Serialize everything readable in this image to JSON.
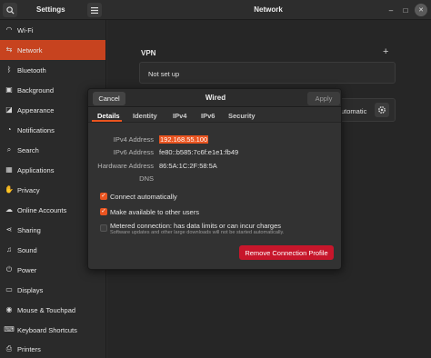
{
  "window": {
    "app_title": "Settings",
    "panel_title": "Network",
    "controls": {
      "minimize": "–",
      "maximize": "□",
      "close": "✕"
    }
  },
  "sidebar": {
    "items": [
      {
        "label": "Wi-Fi",
        "icon": "wifi-icon",
        "glyph": "◠",
        "active": false
      },
      {
        "label": "Network",
        "icon": "network-icon",
        "glyph": "⇆",
        "active": true
      },
      {
        "label": "Bluetooth",
        "icon": "bluetooth-icon",
        "glyph": "ᛒ",
        "active": false
      },
      {
        "label": "Background",
        "icon": "background-icon",
        "glyph": "▣",
        "active": false
      },
      {
        "label": "Appearance",
        "icon": "appearance-icon",
        "glyph": "◪",
        "active": false
      },
      {
        "label": "Notifications",
        "icon": "notifications-icon",
        "glyph": "◔",
        "active": false
      },
      {
        "label": "Search",
        "icon": "search-icon",
        "glyph": "⌕",
        "active": false
      },
      {
        "label": "Applications",
        "icon": "applications-icon",
        "glyph": "▦",
        "active": false
      },
      {
        "label": "Privacy",
        "icon": "privacy-icon",
        "glyph": "✋",
        "active": false
      },
      {
        "label": "Online Accounts",
        "icon": "online-accounts-icon",
        "glyph": "☁",
        "active": false
      },
      {
        "label": "Sharing",
        "icon": "sharing-icon",
        "glyph": "⋖",
        "active": false
      },
      {
        "label": "Sound",
        "icon": "sound-icon",
        "glyph": "♫",
        "active": false
      },
      {
        "label": "Power",
        "icon": "power-icon",
        "glyph": "⏻",
        "active": false
      },
      {
        "label": "Displays",
        "icon": "displays-icon",
        "glyph": "▭",
        "active": false
      },
      {
        "label": "Mouse & Touchpad",
        "icon": "mouse-icon",
        "glyph": "◉",
        "active": false
      },
      {
        "label": "Keyboard Shortcuts",
        "icon": "keyboard-icon",
        "glyph": "⌨",
        "active": false
      },
      {
        "label": "Printers",
        "icon": "printer-icon",
        "glyph": "⎙",
        "active": false
      }
    ]
  },
  "main": {
    "vpn": {
      "title": "VPN",
      "add": "+",
      "status": "Not set up"
    },
    "proxy": {
      "status": "Automatic"
    }
  },
  "dialog": {
    "title": "Wired",
    "cancel_label": "Cancel",
    "apply_label": "Apply",
    "tabs": [
      "Details",
      "Identity",
      "IPv4",
      "IPv6",
      "Security"
    ],
    "active_tab": "Details",
    "details": [
      {
        "label": "IPv4 Address",
        "value": "192.168.55.100"
      },
      {
        "label": "IPv6 Address",
        "value": "fe80::b585:7c6f:e1e1:fb49"
      },
      {
        "label": "Hardware Address",
        "value": "86:5A:1C:2F:58:5A"
      },
      {
        "label": "DNS",
        "value": ""
      }
    ],
    "options": [
      {
        "label": "Connect automatically",
        "checked": true
      },
      {
        "label": "Make available to other users",
        "checked": true
      },
      {
        "label": "Metered connection: has data limits or can incur charges",
        "checked": false,
        "sub": "Software updates and other large downloads will not be started automatically."
      }
    ],
    "remove_label": "Remove Connection Profile"
  },
  "colors": {
    "accent": "#e95420",
    "sidebar_active": "#c7431f",
    "danger": "#c7162b"
  }
}
